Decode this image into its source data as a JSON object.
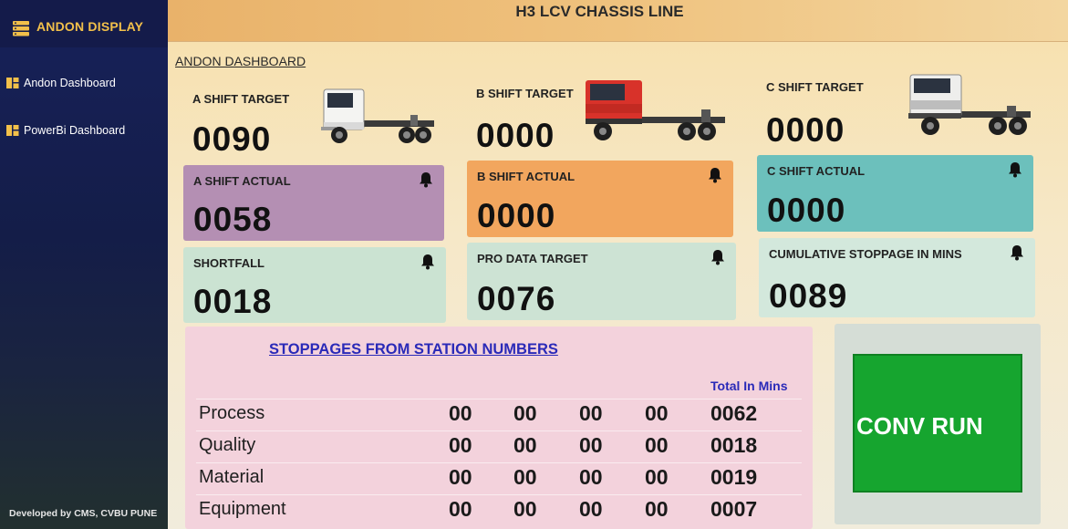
{
  "sidebar": {
    "brand": "ANDON DISPLAY",
    "brand_icon": "server-icon",
    "items": [
      {
        "label": "Andon Dashboard",
        "icon": "dashboard-icon"
      },
      {
        "label": "PowerBi Dashboard",
        "icon": "dashboard-icon"
      }
    ],
    "footer": "Developed by CMS, CVBU PUNE"
  },
  "header": {
    "title": "H3 LCV CHASSIS LINE"
  },
  "main": {
    "dashboard_link": "ANDON DASHBOARD",
    "targets": [
      {
        "label": "A SHIFT TARGET",
        "value": "0090"
      },
      {
        "label": "B SHIFT TARGET",
        "value": "0000"
      },
      {
        "label": "C SHIFT TARGET",
        "value": "0000"
      }
    ],
    "cards": [
      {
        "label": "A SHIFT ACTUAL",
        "value": "0058",
        "color": "#b48fb3"
      },
      {
        "label": "B SHIFT ACTUAL",
        "value": "0000",
        "color": "#f2a65e"
      },
      {
        "label": "C SHIFT ACTUAL",
        "value": "0000",
        "color": "#6cc0bc"
      },
      {
        "label": "SHORTFALL",
        "value": "0018",
        "color": "#cbe3d2"
      },
      {
        "label": "PRO DATA TARGET",
        "value": "0076",
        "color": "#cde3d4"
      },
      {
        "label": "CUMULATIVE STOPPAGE IN MINS",
        "value": "0089",
        "color": "#d3e8dc"
      }
    ],
    "stoppages": {
      "title": "STOPPAGES FROM STATION NUMBERS",
      "total_header": "Total In Mins",
      "rows": [
        {
          "name": "Process",
          "values": [
            "00",
            "00",
            "00",
            "00"
          ],
          "total": "0062"
        },
        {
          "name": "Quality",
          "values": [
            "00",
            "00",
            "00",
            "00"
          ],
          "total": "0018"
        },
        {
          "name": "Material",
          "values": [
            "00",
            "00",
            "00",
            "00"
          ],
          "total": "0019"
        },
        {
          "name": "Equipment",
          "values": [
            "00",
            "00",
            "00",
            "00"
          ],
          "total": "0007"
        }
      ]
    },
    "conveyor": {
      "status": "CONV RUN",
      "color": "#16a52f"
    }
  }
}
